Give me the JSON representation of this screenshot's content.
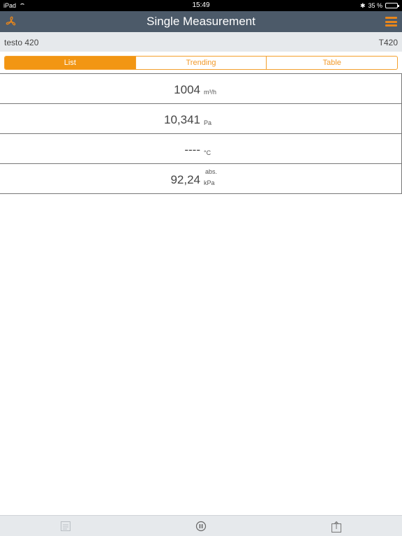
{
  "status_bar": {
    "carrier": "iPad",
    "time": "15:49",
    "battery_percent": "35 %",
    "battery_level": 0.35
  },
  "nav": {
    "title": "Single Measurement",
    "left_icon": "fan-icon",
    "right_icon": "menu-icon",
    "accent_color": "#e8861b"
  },
  "device": {
    "name": "testo 420",
    "model": "T420"
  },
  "tabs": [
    {
      "label": "List",
      "active": true
    },
    {
      "label": "Trending",
      "active": false
    },
    {
      "label": "Table",
      "active": false
    }
  ],
  "measurements": [
    {
      "value": "1004",
      "unit": "m³/h",
      "unit_top": ""
    },
    {
      "value": "10,341",
      "unit": "Pa",
      "unit_top": ""
    },
    {
      "value": "----",
      "unit": "°C",
      "unit_top": ""
    },
    {
      "value": "92,24",
      "unit": "kPa",
      "unit_top": "abs."
    }
  ],
  "toolbar": {
    "items": [
      "report-icon",
      "pause-icon",
      "share-icon"
    ]
  }
}
